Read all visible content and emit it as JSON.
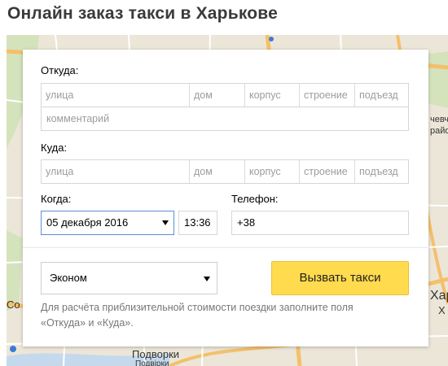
{
  "page": {
    "title": "Онлайн заказ такси в Харькове"
  },
  "map": {
    "labels": {
      "left": "Со",
      "right_top": "Харків",
      "right_side_a": "чевчен",
      "right_side_b": "район",
      "bottom": "Подворки",
      "bottom_sub": "Подвірки",
      "right_bottom": "Хар",
      "right_bottom_b": "Х"
    },
    "colors": {
      "background": "#ece6d9",
      "road_major": "#f5c26b",
      "road_minor": "#ffffff",
      "water": "#b9d3ea",
      "park": "#cfe0b5"
    }
  },
  "form": {
    "from": {
      "label": "Откуда:",
      "street_placeholder": "улица",
      "house_placeholder": "дом",
      "block_placeholder": "корпус",
      "building_placeholder": "строение",
      "entrance_placeholder": "подъезд",
      "comment_placeholder": "комментарий"
    },
    "to": {
      "label": "Куда:",
      "street_placeholder": "улица",
      "house_placeholder": "дом",
      "block_placeholder": "корпус",
      "building_placeholder": "строение",
      "entrance_placeholder": "подъезд"
    },
    "when": {
      "label": "Когда:",
      "date_value": "05 декабря 2016",
      "time_value": "13:36"
    },
    "phone": {
      "label": "Телефон:",
      "value": "+38"
    },
    "tariff": {
      "selected": "Эконом"
    },
    "submit_label": "Вызвать такси",
    "hint_line1": "Для расчёта приблизительной стоимости поездки заполните поля",
    "hint_line2": "«Откуда» и «Куда».",
    "colors": {
      "button": "#ffdb4d",
      "focus_border": "#5b8fd6"
    }
  }
}
